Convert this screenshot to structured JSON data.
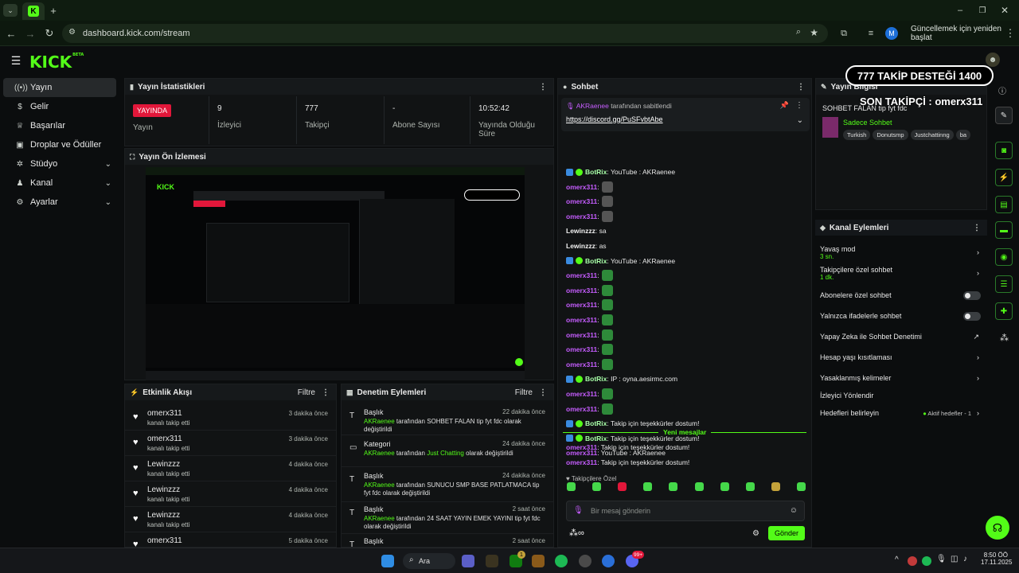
{
  "browser": {
    "url": "dashboard.kick.com/stream",
    "update_label": "Güncellemek için yeniden başlat",
    "profile_initial": "M"
  },
  "logo": {
    "text": "KICK",
    "beta": "BETA"
  },
  "sidebar": {
    "items": [
      {
        "label": "Yayın",
        "icon": "broadcast-icon"
      },
      {
        "label": "Gelir",
        "icon": "dollar-icon"
      },
      {
        "label": "Başarılar",
        "icon": "trophy-icon"
      },
      {
        "label": "Droplar ve Ödüller",
        "icon": "gift-icon"
      },
      {
        "label": "Stüdyo",
        "icon": "gear-icon"
      },
      {
        "label": "Kanal",
        "icon": "user-icon"
      },
      {
        "label": "Ayarlar",
        "icon": "gear-icon"
      }
    ]
  },
  "stats": {
    "title": "Yayın İstatistikleri",
    "live_badge": "YAYINDA",
    "live_label": "Yayın",
    "viewers_value": "9",
    "viewers_label": "İzleyici",
    "followers_value": "777",
    "followers_label": "Takipçi",
    "subs_value": "-",
    "subs_label": "Abone Sayısı",
    "uptime_value": "10:52:42",
    "uptime_label": "Yayında Olduğu Süre"
  },
  "preview": {
    "title": "Yayın Ön İzlemesi"
  },
  "overlay": {
    "goal": "777  TAKİP DESTEĞİ 1400",
    "last_follower": "SON TAKİPÇİ : omerx311"
  },
  "activity": {
    "title": "Etkinlik Akışı",
    "filter": "Filtre",
    "items": [
      {
        "name": "omerx311",
        "sub": "kanalı takip etti",
        "time": "3 dakika önce"
      },
      {
        "name": "omerx311",
        "sub": "kanalı takip etti",
        "time": "3 dakika önce"
      },
      {
        "name": "Lewinzzz",
        "sub": "kanalı takip etti",
        "time": "4 dakika önce"
      },
      {
        "name": "Lewinzzz",
        "sub": "kanalı takip etti",
        "time": "4 dakika önce"
      },
      {
        "name": "Lewinzzz",
        "sub": "kanalı takip etti",
        "time": "4 dakika önce"
      },
      {
        "name": "omerx311",
        "sub": "",
        "time": "5 dakika önce"
      }
    ]
  },
  "moderation": {
    "title": "Denetim Eylemleri",
    "filter": "Filtre",
    "items": [
      {
        "name": "Başlık",
        "user": "AKRaenee",
        "mid": " tarafından ",
        "value": "SOHBET FALAN tip fyt fdc",
        "end": " olarak değiştirildi",
        "time": "22 dakika önce"
      },
      {
        "name": "Kategori",
        "user": "AKRaenee",
        "mid": " tarafından ",
        "value": "Just Chatting",
        "end": " olarak değiştirildi",
        "time": "24 dakika önce"
      },
      {
        "name": "Başlık",
        "user": "AKRaenee",
        "mid": " tarafından ",
        "value": "SUNUCU SMP BASE PATLATMACA tip fyt fdc",
        "end": " olarak değiştirildi",
        "time": "24 dakika önce"
      },
      {
        "name": "Başlık",
        "user": "AKRaenee",
        "mid": " tarafından ",
        "value": "24 SAAT YAYIN EMEK YAYINI tip fyt fdc",
        "end": " olarak değiştirildi",
        "time": "2 saat önce"
      },
      {
        "name": "Başlık",
        "user": "",
        "mid": "",
        "value": "",
        "end": "",
        "time": "2 saat önce"
      }
    ]
  },
  "chat": {
    "title": "Sohbet",
    "pinned_user": "AKRaenee",
    "pinned_by": " tarafından sabitlendi",
    "pinned_link": "https://discord.gg/PuSFvbtAbe",
    "messages": [
      {
        "user": "BotRix",
        "text": ": YouTube : AKRaenee",
        "bot": true
      },
      {
        "user": "omerx311",
        "text": ":",
        "emote": "grey"
      },
      {
        "user": "omerx311",
        "text": ":",
        "emote": "grey"
      },
      {
        "user": "omerx311",
        "text": ":",
        "emote": "grey"
      },
      {
        "user": "Lewinzzz",
        "text": ": sa"
      },
      {
        "user": "Lewinzzz",
        "text": ": as"
      },
      {
        "user": "BotRix",
        "text": ": YouTube : AKRaenee",
        "bot": true
      },
      {
        "user": "omerx311",
        "text": ":",
        "emote": "green"
      },
      {
        "user": "omerx311",
        "text": ":",
        "emote": "green"
      },
      {
        "user": "omerx311",
        "text": ":",
        "emote": "green"
      },
      {
        "user": "omerx311",
        "text": ":",
        "emote": "green"
      },
      {
        "user": "omerx311",
        "text": ":",
        "emote": "green"
      },
      {
        "user": "omerx311",
        "text": ":",
        "emote": "green"
      },
      {
        "user": "omerx311",
        "text": ":",
        "emote": "green"
      },
      {
        "user": "BotRix",
        "text": ": IP : oyna.aesirmc.com",
        "bot": true
      },
      {
        "user": "omerx311",
        "text": ":",
        "emote": "green"
      },
      {
        "user": "omerx311",
        "text": ":",
        "emote": "green"
      },
      {
        "user": "BotRix",
        "text": ": Takip için teşekkürler dostum!",
        "bot": true
      },
      {
        "user": "BotRix",
        "text": ": Takip için teşekkürler dostum!",
        "bot": true
      },
      {
        "user": "omerx311",
        "text": ": YouTube : AKRaenee"
      }
    ],
    "new_messages": "Yeni mesajlar",
    "after": [
      {
        "user": "omerx311",
        "text": ": Takip için teşekkürler dostum!"
      },
      {
        "user": "omerx311",
        "text": ": Takip için teşekkürler dostum!"
      }
    ],
    "followers_only": "Takipçilere Özel",
    "input_placeholder": "Bir mesaj gönderin",
    "send": "Gönder"
  },
  "stream_info": {
    "title": "Yayın Bilgisi",
    "stream_title": "SOHBET FALAN tip fyt fdc",
    "category": "Sadece Sohbet",
    "tags": [
      "Turkish",
      "Donutsmp",
      "Justchattinng",
      "ba"
    ]
  },
  "channel_actions": {
    "title": "Kanal Eylemleri",
    "slow_mode": "Yavaş mod",
    "slow_mode_sub": "3 sn.",
    "followers_chat": "Takipçilere özel sohbet",
    "followers_chat_sub": "1 dk.",
    "subs_chat": "Abonelere özel sohbet",
    "emotes_chat": "Yalnızca ifadelerle sohbet",
    "ai_mod": "Yapay Zeka ile Sohbet Denetimi",
    "age": "Hesap yaşı kısıtlaması",
    "banned_words": "Yasaklanmış kelimeler",
    "host": "İzleyici Yönlendir",
    "goals": "Hedefleri belirleyin",
    "goals_status": "Aktif hedefler - 1"
  },
  "taskbar": {
    "search": "Ara",
    "time": "8:50 ÖÖ",
    "date": "17.11.2025",
    "badge1": "1",
    "badge2": "99+"
  },
  "colors": {
    "accent": "#53fc18",
    "live": "#e2173a",
    "purple": "#c65dff"
  }
}
